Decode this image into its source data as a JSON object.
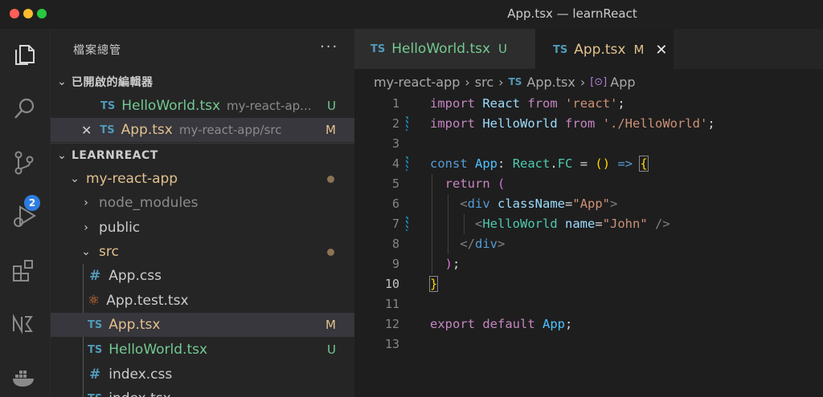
{
  "window": {
    "title": "App.tsx — learnReact"
  },
  "activity_bar": {
    "icons": [
      "explorer-icon",
      "search-icon",
      "source-control-icon",
      "run-debug-icon",
      "extensions-icon",
      "nx-icon",
      "docker-icon"
    ],
    "source_control_badge": "2"
  },
  "sidebar": {
    "title": "檔案總管",
    "more": "···",
    "open_editors": {
      "label": "已開啟的編輯器",
      "items": [
        {
          "icon": "TS",
          "name": "HelloWorld.tsx",
          "path": "my-react-ap...",
          "status": "U"
        },
        {
          "icon": "TS",
          "name": "App.tsx",
          "path": "my-react-app/src",
          "status": "M"
        }
      ]
    },
    "project": {
      "label": "LEARNREACT",
      "root": "my-react-app",
      "folders": [
        "node_modules",
        "public",
        "src"
      ],
      "src_files": [
        {
          "icon": "#",
          "name": "App.css",
          "status": ""
        },
        {
          "icon": "react",
          "name": "App.test.tsx",
          "status": ""
        },
        {
          "icon": "TS",
          "name": "App.tsx",
          "status": "M"
        },
        {
          "icon": "TS",
          "name": "HelloWorld.tsx",
          "status": "U"
        },
        {
          "icon": "#",
          "name": "index.css",
          "status": ""
        },
        {
          "icon": "TS",
          "name": "index.tsx",
          "status": ""
        }
      ]
    }
  },
  "tabs": [
    {
      "icon": "TS",
      "label": "HelloWorld.tsx",
      "status": "U"
    },
    {
      "icon": "TS",
      "label": "App.tsx",
      "status": "M",
      "close": "✕"
    }
  ],
  "breadcrumb": {
    "parts": [
      "my-react-app",
      "src",
      "App.tsx",
      "App"
    ]
  },
  "editor": {
    "line_numbers": [
      "1",
      "2",
      "3",
      "4",
      "5",
      "6",
      "7",
      "8",
      "9",
      "10",
      "11",
      "12",
      "13"
    ],
    "current_line": "10"
  },
  "colors": {
    "accent_blue": "#2d7de0",
    "untracked_green": "#73c991",
    "modified_yellow": "#e2c08d",
    "ts_icon_blue": "#519aba"
  }
}
